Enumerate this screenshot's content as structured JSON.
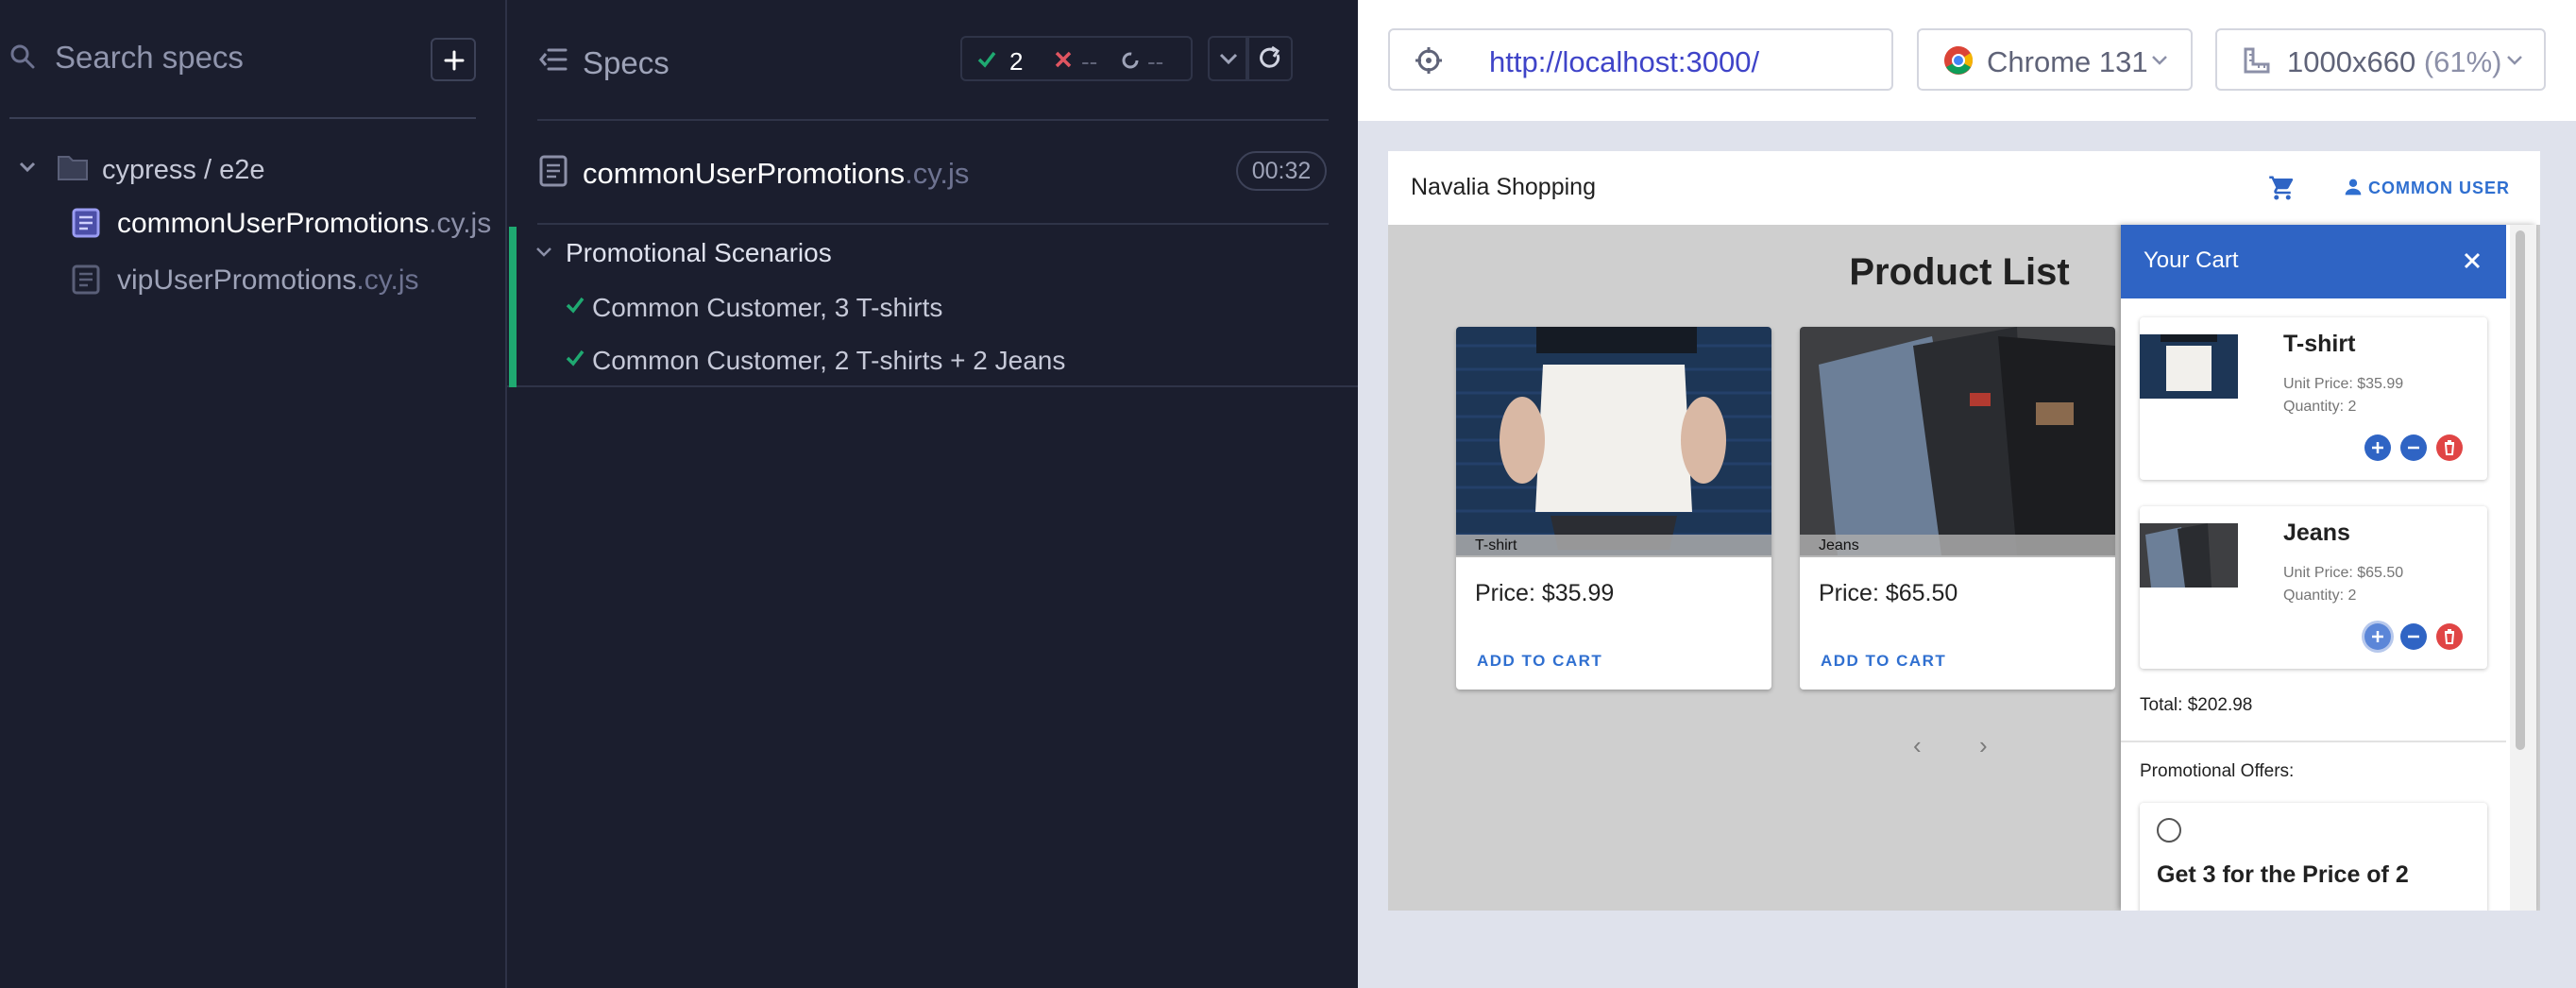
{
  "sidebar": {
    "search_placeholder": "Search specs",
    "folder": "cypress / e2e",
    "files": [
      {
        "name": "commonUserPromotions",
        "ext": ".cy.js"
      },
      {
        "name": "vipUserPromotions",
        "ext": ".cy.js"
      }
    ]
  },
  "reporter": {
    "title": "Specs",
    "stats": {
      "passed": "2",
      "failed": "--",
      "pending": "--"
    },
    "running_file": {
      "name": "commonUserPromotions",
      "ext": ".cy.js",
      "duration": "00:32"
    },
    "suite": "Promotional Scenarios",
    "tests": [
      "Common Customer, 3 T-shirts",
      "Common Customer, 2 T-shirts + 2 Jeans"
    ]
  },
  "toolbar": {
    "url": "http://localhost:3000/",
    "browser": "Chrome 131",
    "viewport": "1000x660",
    "viewport_scale": "(61%)"
  },
  "app": {
    "brand": "Navalia Shopping",
    "user": "COMMON USER",
    "page_title": "Product List",
    "products": [
      {
        "name": "T-shirt",
        "price": "Price: $35.99",
        "add_label": "ADD TO CART"
      },
      {
        "name": "Jeans",
        "price": "Price: $65.50",
        "add_label": "ADD TO CART"
      }
    ],
    "pager_prev": "‹",
    "pager_next": "›",
    "cart": {
      "title": "Your Cart",
      "items": [
        {
          "name": "T-shirt",
          "unit_price": "Unit Price: $35.99",
          "quantity": "Quantity: 2"
        },
        {
          "name": "Jeans",
          "unit_price": "Unit Price: $65.50",
          "quantity": "Quantity: 2"
        }
      ],
      "total": "Total: $202.98",
      "promotions_label": "Promotional Offers:",
      "promotion": "Get 3 for the Price of 2"
    }
  },
  "colors": {
    "accent": "#2f64c4",
    "pass": "#1fa971",
    "fail": "#e05561",
    "link": "#3f44c8"
  }
}
